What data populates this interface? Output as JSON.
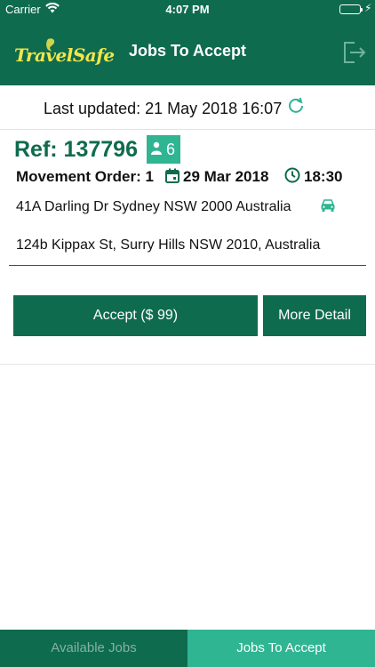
{
  "status_bar": {
    "carrier": "Carrier",
    "time": "4:07 PM"
  },
  "nav": {
    "logo_text": "TravelSafe",
    "title": "Jobs To Accept"
  },
  "last_updated": {
    "text": "Last updated: 21 May 2018 16:07"
  },
  "job": {
    "ref": "Ref: 137796",
    "passenger_count": "6",
    "movement_order": "Movement Order: 1",
    "date": "29 Mar 2018",
    "time": "18:30",
    "pickup_address": "41A Darling Dr Sydney NSW 2000 Australia",
    "dropoff_address": "124b Kippax St, Surry Hills NSW 2010, Australia",
    "accept_label": "Accept ($ 99)",
    "detail_label": "More Detail"
  },
  "tabs": [
    {
      "label": "Available Jobs"
    },
    {
      "label": "Jobs To Accept"
    }
  ],
  "colors": {
    "primary": "#0f6b4e",
    "accent": "#2fb592",
    "logo": "#f2e64a"
  }
}
